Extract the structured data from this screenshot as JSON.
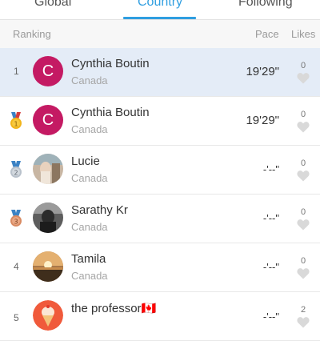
{
  "tabs": [
    {
      "label": "Global"
    },
    {
      "label": "Country",
      "active": true
    },
    {
      "label": "Following"
    }
  ],
  "columns": {
    "ranking": "Ranking",
    "pace": "Pace",
    "likes": "Likes"
  },
  "rows": [
    {
      "rank": "1",
      "medal": null,
      "name": "Cynthia Boutin",
      "location": "Canada",
      "pace": "19'29\"",
      "likes": "0",
      "avatar": "letter",
      "avatar_letter": "C",
      "highlight": true
    },
    {
      "rank": "1",
      "medal": "gold",
      "name": "Cynthia Boutin",
      "location": "Canada",
      "pace": "19'29\"",
      "likes": "0",
      "avatar": "letter",
      "avatar_letter": "C"
    },
    {
      "rank": "2",
      "medal": "silver",
      "name": "Lucie",
      "location": "Canada",
      "pace": "-'--\"",
      "likes": "0",
      "avatar": "photo"
    },
    {
      "rank": "3",
      "medal": "bronze",
      "name": "Sarathy Kr",
      "location": "Canada",
      "pace": "-'--\"",
      "likes": "0",
      "avatar": "photo"
    },
    {
      "rank": "4",
      "medal": null,
      "name": "Tamila",
      "location": "Canada",
      "pace": "-'--\"",
      "likes": "0",
      "avatar": "photo"
    },
    {
      "rank": "5",
      "medal": null,
      "name": "the professor🇨🇦",
      "location": "",
      "pace": "-'--\"",
      "likes": "2",
      "avatar": "icecream"
    }
  ],
  "colors": {
    "accent": "#2f9ee0",
    "highlight_row": "#e4ecf7",
    "avatar_letter_bg": "#c41a63"
  }
}
